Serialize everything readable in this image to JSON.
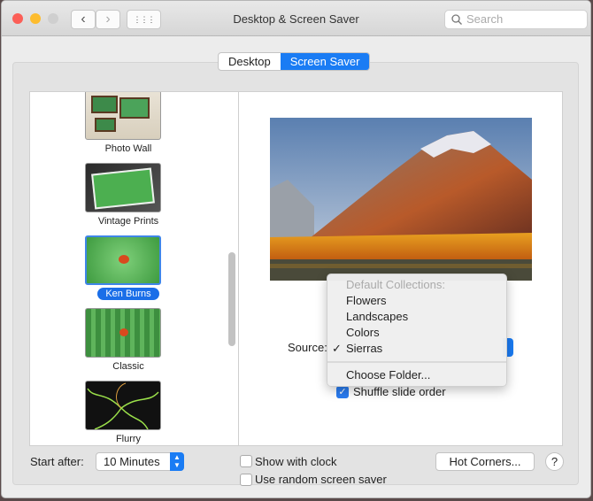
{
  "window": {
    "title": "Desktop & Screen Saver",
    "search_placeholder": "Search"
  },
  "toolbar": {
    "back": "‹",
    "forward": "›",
    "grid": "⋮⋮⋮"
  },
  "tabs": [
    {
      "label": "Desktop",
      "active": false
    },
    {
      "label": "Screen Saver",
      "active": true
    }
  ],
  "savers": [
    {
      "label": "Photo Wall"
    },
    {
      "label": "Vintage Prints"
    },
    {
      "label": "Ken Burns",
      "selected": true
    },
    {
      "label": "Classic"
    },
    {
      "label": "Flurry"
    }
  ],
  "options": {
    "source_label": "Source:",
    "shuffle_label": "Shuffle slide order",
    "shuffle_checked": true
  },
  "source_menu": {
    "header": "Default Collections:",
    "items": [
      "Flowers",
      "Landscapes",
      "Colors",
      "Sierras"
    ],
    "selected": "Sierras",
    "check": "✓",
    "choose_folder": "Choose Folder..."
  },
  "bottom": {
    "start_after_label": "Start after:",
    "start_after_value": "10 Minutes",
    "show_clock_label": "Show with clock",
    "random_label": "Use random screen saver",
    "hot_corners": "Hot Corners...",
    "help": "?"
  },
  "colors": {
    "accent": "#1a7cf4"
  }
}
